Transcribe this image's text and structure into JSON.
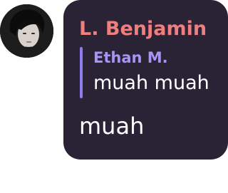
{
  "message": {
    "sender_name": "L. Benjamin",
    "sender_color": "#f07e7e",
    "avatar_icon": "user-avatar-photo",
    "bubble_color": "#2a2235",
    "reply": {
      "author": "Ethan M.",
      "author_color": "#a596f5",
      "bar_color": "#8c7cf0",
      "text": "muah muah"
    },
    "text": "muah"
  }
}
